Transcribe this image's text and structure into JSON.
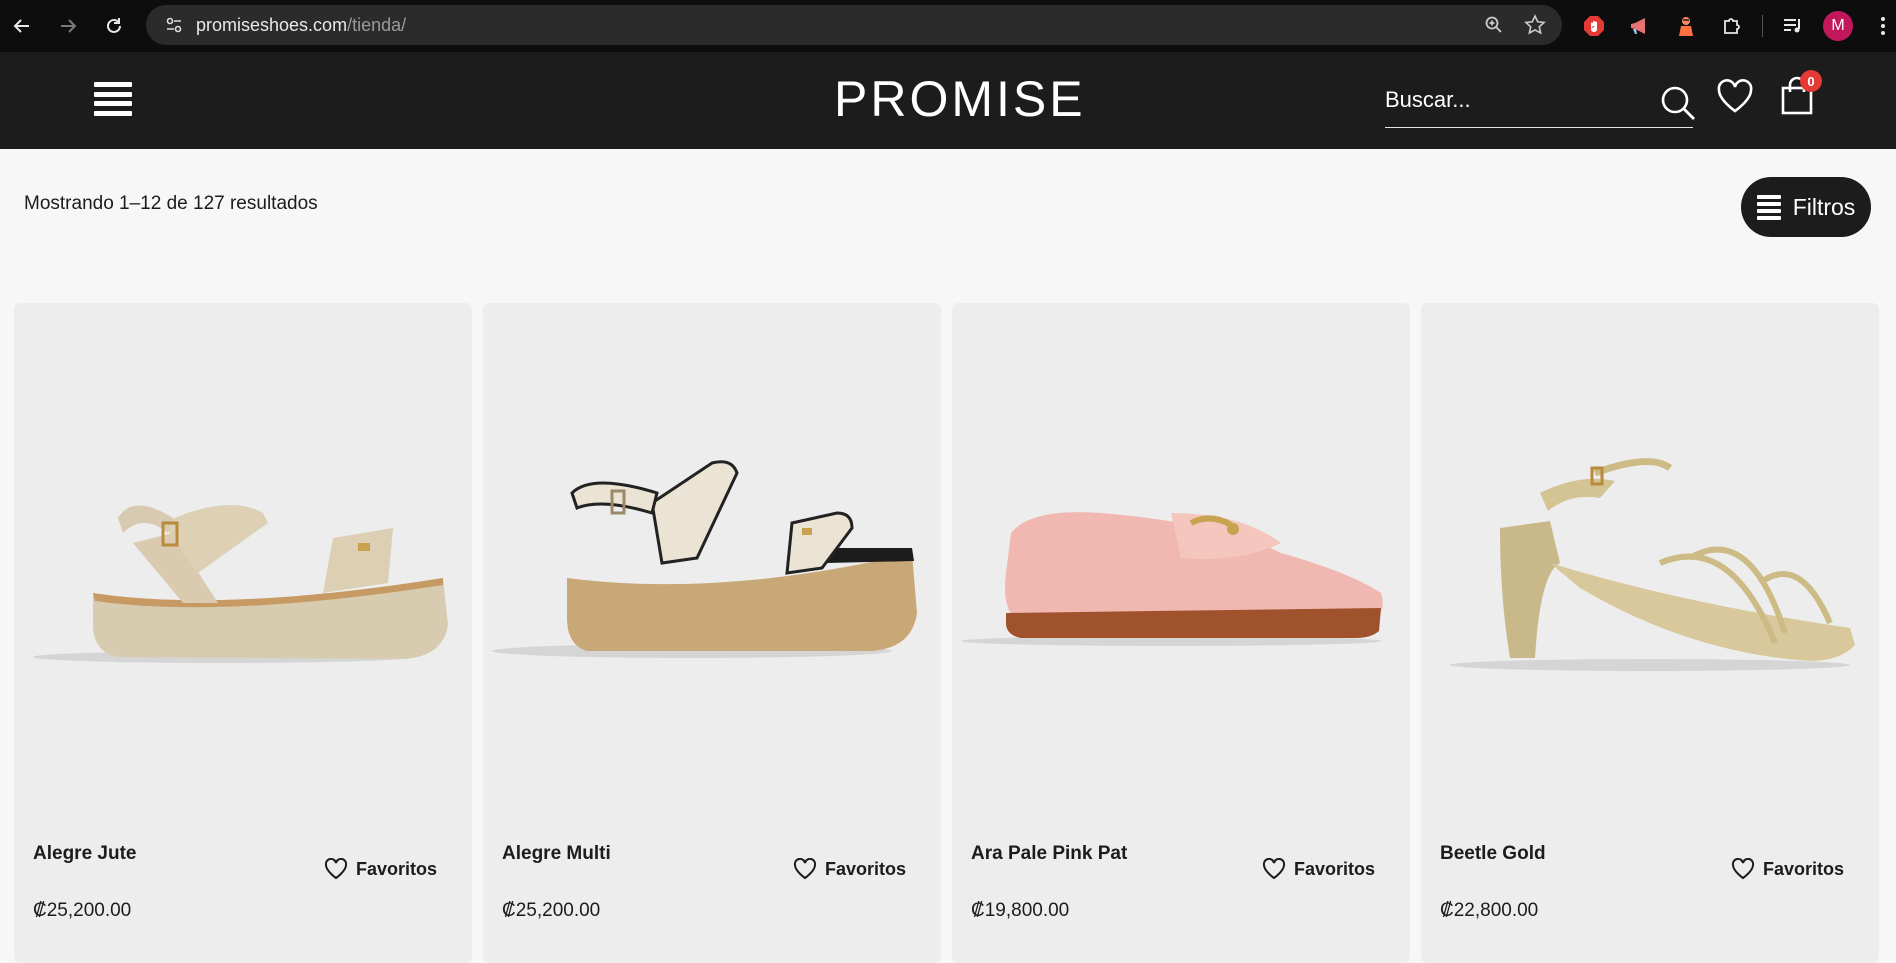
{
  "browser": {
    "url_host": "promiseshoes.com",
    "url_path": "/tienda/",
    "profile_initial": "M"
  },
  "header": {
    "logo": "PROMISE",
    "search_placeholder": "Buscar...",
    "cart_count": "0"
  },
  "toolbar": {
    "results_text": "Mostrando 1–12 de 127 resultados",
    "filter_label": "Filtros"
  },
  "products": [
    {
      "name": "Alegre Jute",
      "price": "₡25,200.00",
      "fav_label": "Favoritos"
    },
    {
      "name": "Alegre Multi",
      "price": "₡25,200.00",
      "fav_label": "Favoritos"
    },
    {
      "name": "Ara Pale Pink Pat",
      "price": "₡19,800.00",
      "fav_label": "Favoritos"
    },
    {
      "name": "Beetle Gold",
      "price": "₡22,800.00",
      "fav_label": "Favoritos"
    }
  ],
  "colors": {
    "header_bg": "#1c1c1c",
    "card_bg": "#ededed",
    "badge": "#e53935"
  }
}
